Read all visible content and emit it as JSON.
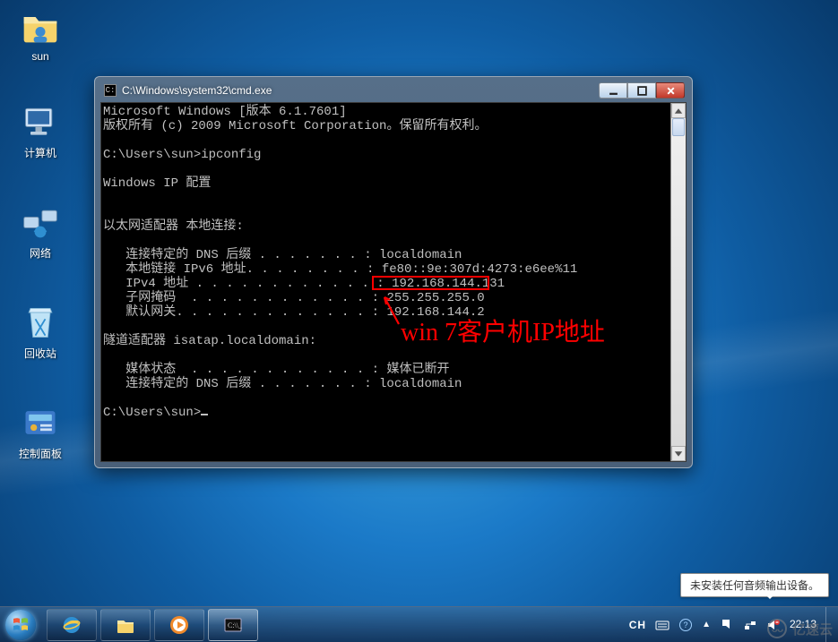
{
  "desktop_icons": {
    "folder": {
      "label": "sun"
    },
    "computer": {
      "label": "计算机"
    },
    "network": {
      "label": "网络"
    },
    "recycle": {
      "label": "回收站"
    },
    "cpanel": {
      "label": "控制面板"
    }
  },
  "cmd_window": {
    "title": "C:\\Windows\\system32\\cmd.exe",
    "lines": {
      "l1": "Microsoft Windows [版本 6.1.7601]",
      "l2": "版权所有 (c) 2009 Microsoft Corporation。保留所有权利。",
      "l3": "",
      "l4": "C:\\Users\\sun>ipconfig",
      "l5": "",
      "l6": "Windows IP 配置",
      "l7": "",
      "l8": "",
      "l9": "以太网适配器 本地连接:",
      "l10": "",
      "l11": "   连接特定的 DNS 后缀 . . . . . . . : localdomain",
      "l12": "   本地链接 IPv6 地址. . . . . . . . : fe80::9e:307d:4273:e6ee%11",
      "l13_prefix": "   IPv4 地址 . . . . . . . . . . . . : ",
      "l13_value": "192.168.144.131",
      "l14": "   子网掩码  . . . . . . . . . . . . : 255.255.255.0",
      "l15": "   默认网关. . . . . . . . . . . . . : 192.168.144.2",
      "l16": "",
      "l17": "隧道适配器 isatap.localdomain:",
      "l18": "",
      "l19": "   媒体状态  . . . . . . . . . . . . : 媒体已断开",
      "l20": "   连接特定的 DNS 后缀 . . . . . . . : localdomain",
      "l21": "",
      "l22_prompt": "C:\\Users\\sun>"
    }
  },
  "annotation": {
    "text": "win 7客户机IP地址"
  },
  "balloon": {
    "text": "未安装任何音频输出设备。"
  },
  "systray": {
    "ime": "CH",
    "clock_time": "22:13"
  },
  "watermark": {
    "text": "亿速云"
  }
}
